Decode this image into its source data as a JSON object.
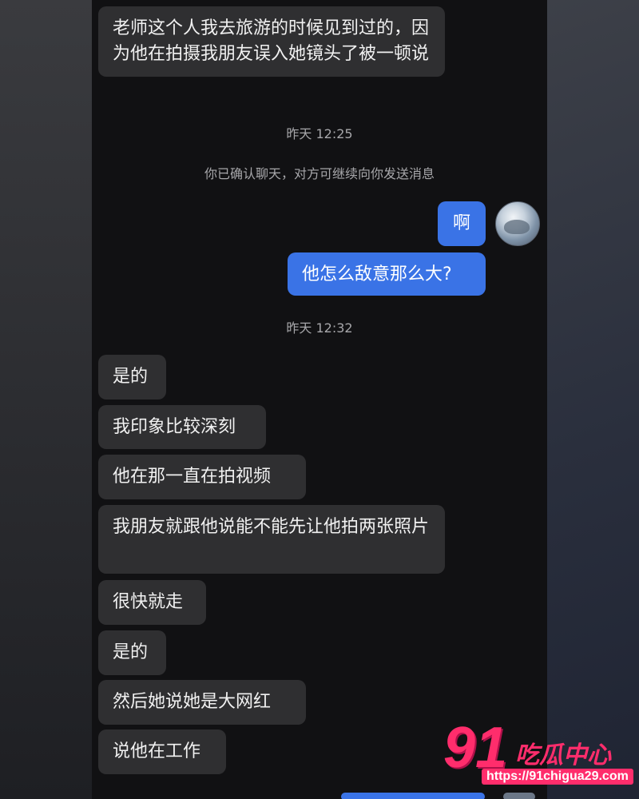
{
  "messages": [
    {
      "text": "老师这个人我去旅游的时候见到过的，因为他在拍摄我朋友误入她镜头了被一顿说"
    },
    {
      "text": "啊"
    },
    {
      "text": "他怎么敌意那么大?"
    },
    {
      "text": "是的"
    },
    {
      "text": "我印象比较深刻"
    },
    {
      "text": "他在那一直在拍视频"
    },
    {
      "text": "我朋友就跟他说能不能先让他拍两张照片"
    },
    {
      "text": "很快就走"
    },
    {
      "text": "是的"
    },
    {
      "text": "然后她说她是大网红"
    },
    {
      "text": "说他在工作"
    }
  ],
  "timestamps": [
    "昨天 12:25",
    "昨天 12:32"
  ],
  "system_notice": "你已确认聊天，对方可继续向你发送消息",
  "watermark": {
    "number": "91",
    "text": "吃瓜中心",
    "url": "https://91chigua29.com"
  },
  "colors": {
    "outgoing_bubble": "#3a73e6",
    "incoming_bubble": "#2f2f31",
    "chat_background": "#111113",
    "watermark": "#ff2d6c"
  },
  "icons": [
    "avatar"
  ]
}
